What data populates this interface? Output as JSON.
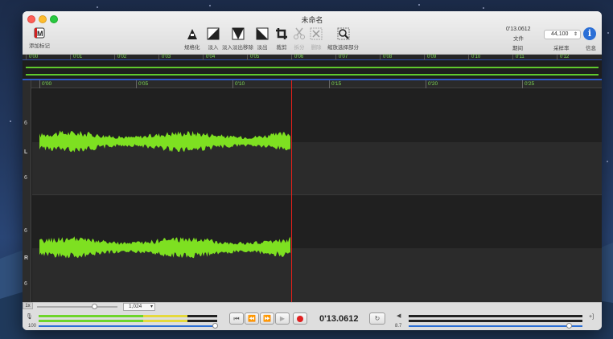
{
  "window": {
    "title": "未命名"
  },
  "toolbar": {
    "add_marker": "添加标记",
    "normalize": "规格化",
    "fade_in": "淡入",
    "fade_in_out": "淡入淡出移除",
    "fade_out": "淡出",
    "crop": "裁剪",
    "split": "拆分",
    "delete": "删除",
    "zoom_selection": "缩放选择部分",
    "duration_value": "0'13.0612",
    "file_label": "文件",
    "duration_label": "期间",
    "sample_rate_value": "44,100",
    "sample_rate_label": "采样率",
    "info_label": "信息"
  },
  "overview": {
    "ticks": [
      "0'00",
      "0'01",
      "0'02",
      "0'03",
      "0'04",
      "0'05",
      "0'06",
      "0'07",
      "0'08",
      "0'09",
      "0'10",
      "0'11",
      "0'12"
    ]
  },
  "ruler": {
    "ticks": [
      "0'00",
      "0'05",
      "0'10",
      "0'15",
      "0'20",
      "0'25"
    ]
  },
  "tracks": {
    "left": {
      "channel": "L",
      "upper_mark": "6",
      "lower_mark": "6"
    },
    "right": {
      "channel": "R",
      "upper_mark": "6",
      "lower_mark": "6"
    }
  },
  "bottom": {
    "zoom_label": "1x",
    "zoom_select": "1,024",
    "input_level": "100",
    "output_level": "8.7",
    "time": "0'13.0612"
  },
  "colors": {
    "waveform": "#7ee021",
    "cursor": "#e0201a",
    "accent": "#2b6fd6"
  }
}
